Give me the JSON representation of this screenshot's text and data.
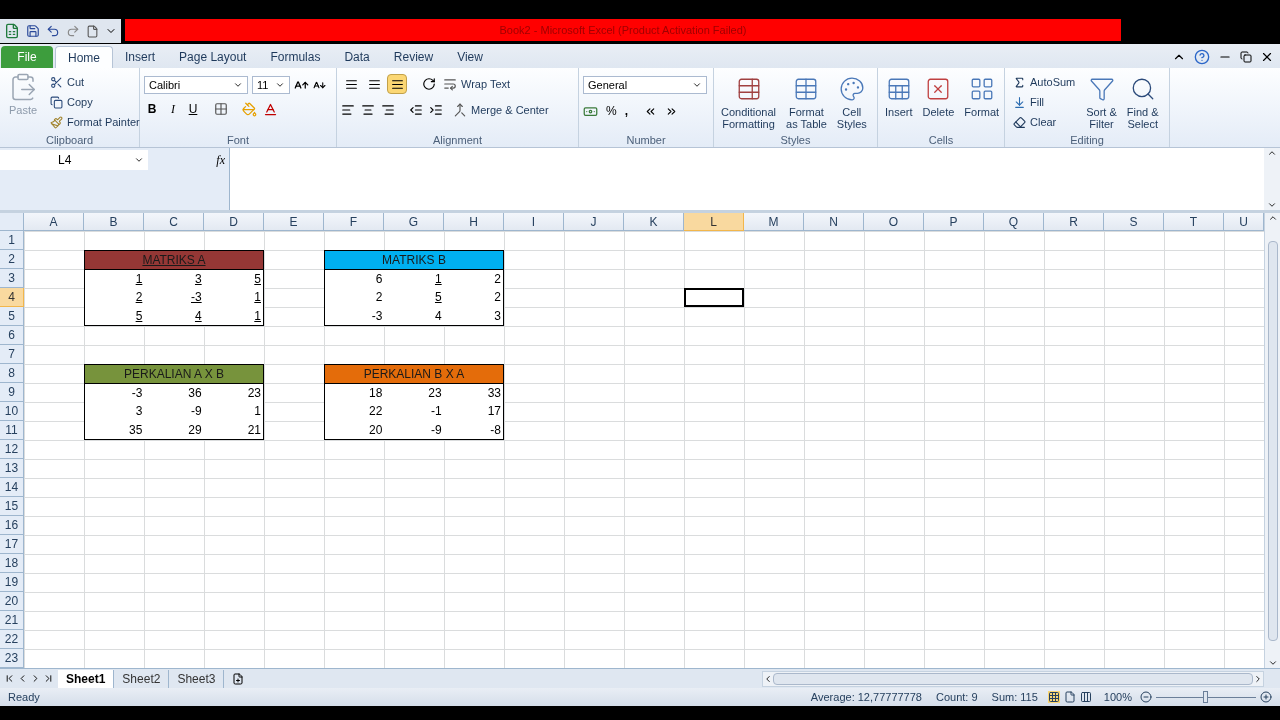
{
  "window": {
    "title": "Book2  -  Microsoft Excel (Product Activation Failed)"
  },
  "tabs": [
    {
      "label": "File",
      "kind": "file",
      "selected": false
    },
    {
      "label": "Home",
      "kind": "tab",
      "selected": true
    },
    {
      "label": "Insert",
      "kind": "tab",
      "selected": false
    },
    {
      "label": "Page Layout",
      "kind": "tab",
      "selected": false
    },
    {
      "label": "Formulas",
      "kind": "tab",
      "selected": false
    },
    {
      "label": "Data",
      "kind": "tab",
      "selected": false
    },
    {
      "label": "Review",
      "kind": "tab",
      "selected": false
    },
    {
      "label": "View",
      "kind": "tab",
      "selected": false
    }
  ],
  "ribbon": {
    "clipboard": {
      "label": "Clipboard",
      "paste": {
        "label": "Paste",
        "disabled": true
      },
      "cut": "Cut",
      "copy": "Copy",
      "format_painter": "Format Painter"
    },
    "font": {
      "label": "Font",
      "font_name": "Calibri",
      "font_size": "11",
      "bold": "B",
      "italic": "I",
      "underline": "U"
    },
    "alignment": {
      "label": "Alignment",
      "vertical": [
        {
          "selected": false
        },
        {
          "selected": false
        },
        {
          "selected": true
        }
      ],
      "wrap_text": "Wrap Text",
      "merge_center": "Merge & Center"
    },
    "number": {
      "label": "Number",
      "format": "General",
      "percent": "%",
      "comma": ","
    },
    "styles": {
      "label": "Styles",
      "conditional_formatting": "Conditional\nFormatting",
      "format_as_table": "Format\nas Table",
      "cell_styles": "Cell\nStyles"
    },
    "cells": {
      "label": "Cells",
      "insert": "Insert",
      "delete": "Delete",
      "format": "Format"
    },
    "editing": {
      "label": "Editing",
      "autosum": "AutoSum",
      "fill": "Fill",
      "clear": "Clear",
      "sort_filter": "Sort &\nFilter",
      "find_select": "Find &\nSelect"
    }
  },
  "formula_bar": {
    "name_box": "L4",
    "fx": "fx"
  },
  "columns": [
    {
      "label": "A",
      "selected": false
    },
    {
      "label": "B",
      "selected": false
    },
    {
      "label": "C",
      "selected": false
    },
    {
      "label": "D",
      "selected": false
    },
    {
      "label": "E",
      "selected": false
    },
    {
      "label": "F",
      "selected": false
    },
    {
      "label": "G",
      "selected": false
    },
    {
      "label": "H",
      "selected": false
    },
    {
      "label": "I",
      "selected": false
    },
    {
      "label": "J",
      "selected": false
    },
    {
      "label": "K",
      "selected": false
    },
    {
      "label": "L",
      "selected": true
    },
    {
      "label": "M",
      "selected": false
    },
    {
      "label": "N",
      "selected": false
    },
    {
      "label": "O",
      "selected": false
    },
    {
      "label": "P",
      "selected": false
    },
    {
      "label": "Q",
      "selected": false
    },
    {
      "label": "R",
      "selected": false
    },
    {
      "label": "S",
      "selected": false
    },
    {
      "label": "T",
      "selected": false
    },
    {
      "label": "U",
      "selected": false
    }
  ],
  "rows": [
    {
      "label": "1",
      "selected": false
    },
    {
      "label": "2",
      "selected": false
    },
    {
      "label": "3",
      "selected": false
    },
    {
      "label": "4",
      "selected": true
    },
    {
      "label": "5",
      "selected": false
    },
    {
      "label": "6",
      "selected": false
    },
    {
      "label": "7",
      "selected": false
    },
    {
      "label": "8",
      "selected": false
    },
    {
      "label": "9",
      "selected": false
    },
    {
      "label": "10",
      "selected": false
    },
    {
      "label": "11",
      "selected": false
    },
    {
      "label": "12",
      "selected": false
    },
    {
      "label": "13",
      "selected": false
    },
    {
      "label": "14",
      "selected": false
    },
    {
      "label": "15",
      "selected": false
    },
    {
      "label": "16",
      "selected": false
    },
    {
      "label": "17",
      "selected": false
    },
    {
      "label": "18",
      "selected": false
    },
    {
      "label": "19",
      "selected": false
    },
    {
      "label": "20",
      "selected": false
    },
    {
      "label": "21",
      "selected": false
    },
    {
      "label": "22",
      "selected": false
    },
    {
      "label": "23",
      "selected": false
    }
  ],
  "matrices": [
    {
      "title": "MATRIKS A",
      "title_underlined": true,
      "color": "#953735",
      "values": [
        [
          {
            "text": "1",
            "underlined": true
          },
          {
            "text": "3",
            "underlined": true
          },
          {
            "text": "5",
            "underlined": true
          }
        ],
        [
          {
            "text": "2",
            "underlined": true
          },
          {
            "text": "-3",
            "underlined": true
          },
          {
            "text": "1",
            "underlined": true
          }
        ],
        [
          {
            "text": "5",
            "underlined": true
          },
          {
            "text": "4",
            "underlined": true
          },
          {
            "text": "1",
            "underlined": true
          }
        ]
      ]
    },
    {
      "title": "MATRIKS B",
      "title_underlined": false,
      "color": "#00b0f0",
      "values": [
        [
          {
            "text": "6",
            "underlined": false
          },
          {
            "text": "1",
            "underlined": true
          },
          {
            "text": "2",
            "underlined": false
          }
        ],
        [
          {
            "text": "2",
            "underlined": false
          },
          {
            "text": "5",
            "underlined": true
          },
          {
            "text": "2",
            "underlined": false
          }
        ],
        [
          {
            "text": "-3",
            "underlined": false
          },
          {
            "text": "4",
            "underlined": false
          },
          {
            "text": "3",
            "underlined": false
          }
        ]
      ]
    },
    {
      "title": "PERKALIAN A X B",
      "title_underlined": false,
      "color": "#77933c",
      "values": [
        [
          {
            "text": "-3",
            "underlined": false
          },
          {
            "text": "36",
            "underlined": false
          },
          {
            "text": "23",
            "underlined": false
          }
        ],
        [
          {
            "text": "3",
            "underlined": false
          },
          {
            "text": "-9",
            "underlined": false
          },
          {
            "text": "1",
            "underlined": false
          }
        ],
        [
          {
            "text": "35",
            "underlined": false
          },
          {
            "text": "29",
            "underlined": false
          },
          {
            "text": "21",
            "underlined": false
          }
        ]
      ]
    },
    {
      "title": "PERKALIAN B X A",
      "title_underlined": false,
      "color": "#e46c0a",
      "values": [
        [
          {
            "text": "18",
            "underlined": false
          },
          {
            "text": "23",
            "underlined": false
          },
          {
            "text": "33",
            "underlined": false
          }
        ],
        [
          {
            "text": "22",
            "underlined": false
          },
          {
            "text": "-1",
            "underlined": false
          },
          {
            "text": "17",
            "underlined": false
          }
        ],
        [
          {
            "text": "20",
            "underlined": false
          },
          {
            "text": "-9",
            "underlined": false
          },
          {
            "text": "-8",
            "underlined": false
          }
        ]
      ]
    }
  ],
  "sheet_tabs": [
    {
      "label": "Sheet1",
      "selected": true
    },
    {
      "label": "Sheet2",
      "selected": false
    },
    {
      "label": "Sheet3",
      "selected": false
    }
  ],
  "status_bar": {
    "mode": "Ready",
    "average": "Average: 12,77777778",
    "count": "Count: 9",
    "sum": "Sum: 115",
    "zoom": {
      "reading": "100%",
      "level": 0.5
    }
  }
}
